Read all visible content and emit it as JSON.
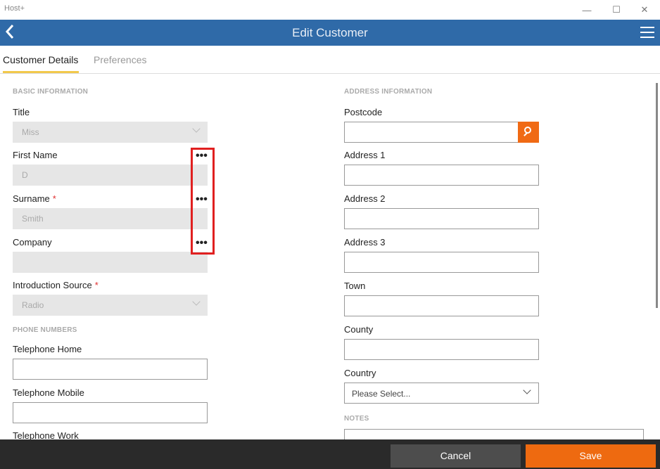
{
  "window": {
    "app_name": "Host+",
    "minimize": "—",
    "maximize": "☐",
    "close": "✕"
  },
  "header": {
    "title": "Edit Customer"
  },
  "tabs": [
    {
      "label": "Customer Details"
    },
    {
      "label": "Preferences"
    }
  ],
  "basic": {
    "heading": "BASIC INFORMATION",
    "title_label": "Title",
    "title_value": "Miss",
    "first_name_label": "First Name",
    "first_name_value": "D",
    "surname_label": "Surname",
    "surname_value": "Smith",
    "company_label": "Company",
    "company_value": "",
    "intro_label": "Introduction Source",
    "intro_value": "Radio",
    "required_mark": "*",
    "more_glyph": "•••"
  },
  "phones": {
    "heading": "PHONE NUMBERS",
    "home_label": "Telephone Home",
    "mobile_label": "Telephone Mobile",
    "work_label": "Telephone Work"
  },
  "address": {
    "heading": "ADDRESS INFORMATION",
    "postcode_label": "Postcode",
    "address1_label": "Address 1",
    "address2_label": "Address 2",
    "address3_label": "Address 3",
    "town_label": "Town",
    "county_label": "County",
    "country_label": "Country",
    "country_value": "Please Select..."
  },
  "notes": {
    "heading": "NOTES"
  },
  "footer": {
    "cancel_label": "Cancel",
    "save_label": "Save"
  },
  "icons": {
    "back": "chevron-left-icon",
    "menu": "hamburger-icon",
    "search": "search-icon"
  },
  "colors": {
    "header": "#2f6aa8",
    "accent": "#ee6a10",
    "tab_underline": "#f2c94c",
    "highlight": "#e02020"
  }
}
